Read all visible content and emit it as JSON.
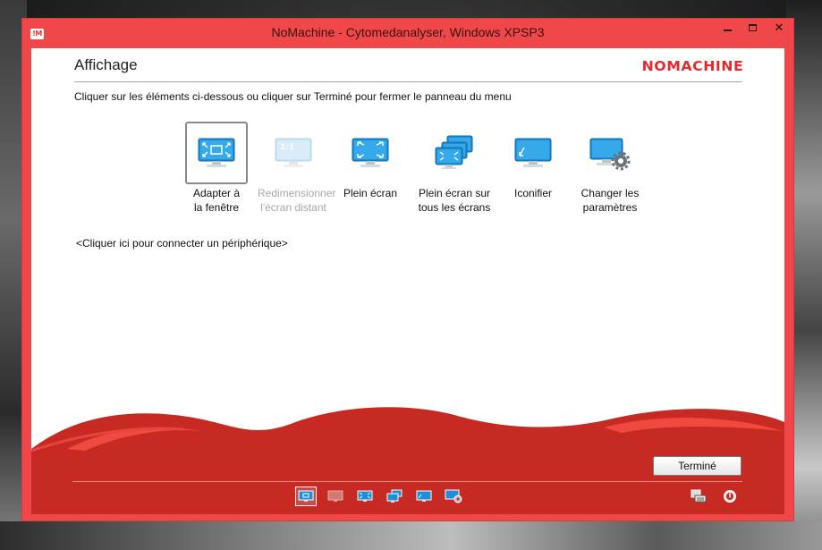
{
  "window": {
    "title": "NoMachine - Cytomedanalyser, Windows XPSP3",
    "app_icon_text": "!M",
    "brand_color": "#f0474a"
  },
  "panel": {
    "title": "Affichage",
    "logo": "NOMACHINE",
    "instruction": "Cliquer sur les éléments ci-dessous ou cliquer sur Terminé pour fermer le panneau du menu",
    "options": [
      {
        "id": "fit",
        "line1": "Adapter à",
        "line2": "la fenêtre",
        "icon": "fit-window-icon",
        "selected": true,
        "enabled": true
      },
      {
        "id": "resize",
        "line1": "Redimensionner",
        "line2": "l'écran distant",
        "icon": "resize-remote-icon",
        "selected": false,
        "enabled": false
      },
      {
        "id": "fullscreen",
        "line1": "Plein écran",
        "line2": "",
        "icon": "fullscreen-icon",
        "selected": false,
        "enabled": true
      },
      {
        "id": "fullscreen-all",
        "line1": "Plein écran sur",
        "line2": "tous les écrans",
        "icon": "fullscreen-all-icon",
        "selected": false,
        "enabled": true
      },
      {
        "id": "iconify",
        "line1": "Iconifier",
        "line2": "",
        "icon": "iconify-icon",
        "selected": false,
        "enabled": true
      },
      {
        "id": "settings",
        "line1": "Changer les",
        "line2": "paramètres",
        "icon": "change-settings-icon",
        "selected": false,
        "enabled": true
      }
    ],
    "connect_link": "<Cliquer ici pour connecter un périphérique>",
    "done_label": "Terminé"
  },
  "toolbar": {
    "items": [
      "fit-window-icon",
      "resize-remote-icon",
      "fullscreen-icon",
      "fullscreen-all-icon",
      "iconify-icon",
      "change-settings-icon"
    ],
    "right_items": [
      "keyboard-display-icon",
      "disconnect-icon"
    ]
  }
}
